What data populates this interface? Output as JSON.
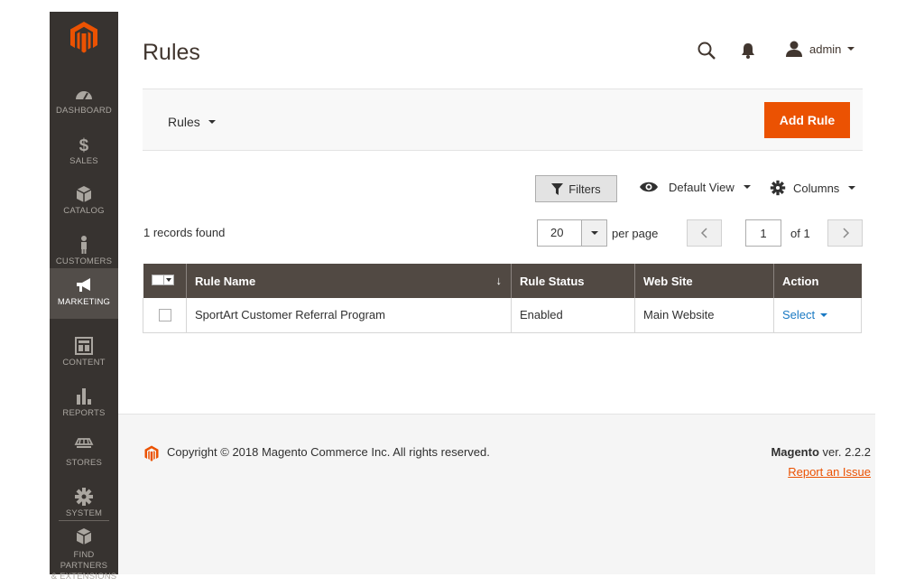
{
  "sidebar": {
    "items": [
      {
        "label": "DASHBOARD",
        "icon": "dashboard-icon"
      },
      {
        "label": "SALES",
        "icon": "dollar-icon"
      },
      {
        "label": "CATALOG",
        "icon": "cube-icon"
      },
      {
        "label": "CUSTOMERS",
        "icon": "person-icon"
      },
      {
        "label": "MARKETING",
        "icon": "megaphone-icon"
      },
      {
        "label": "CONTENT",
        "icon": "layout-icon"
      },
      {
        "label": "REPORTS",
        "icon": "bar-chart-icon"
      },
      {
        "label": "STORES",
        "icon": "store-icon"
      },
      {
        "label": "SYSTEM",
        "icon": "gear-icon"
      }
    ],
    "partners_line1": "FIND PARTNERS",
    "partners_line2": "& EXTENSIONS",
    "active": "MARKETING"
  },
  "header": {
    "title": "Rules",
    "user": "admin"
  },
  "action_bar": {
    "switcher_label": "Rules",
    "add_button": "Add Rule"
  },
  "toolbar": {
    "filters": "Filters",
    "view": "Default View",
    "columns": "Columns",
    "records_found": "1 records found",
    "per_page_value": "20",
    "per_page_label": "per page",
    "page_value": "1",
    "page_of": "of 1"
  },
  "grid": {
    "columns": [
      "Rule Name",
      "Rule Status",
      "Web Site",
      "Action"
    ],
    "sort_indicator": "↓",
    "rows": [
      {
        "rule_name": "SportArt Customer Referral Program",
        "status": "Enabled",
        "website": "Main Website",
        "action": "Select"
      }
    ]
  },
  "footer": {
    "copyright": "Copyright © 2018 Magento Commerce Inc. All rights reserved.",
    "brand": "Magento",
    "version": " ver. 2.2.2",
    "report": "Report an Issue"
  },
  "colors": {
    "accent": "#eb5202",
    "sidebar_bg": "#373330",
    "table_header": "#514943",
    "link": "#1979c3"
  }
}
